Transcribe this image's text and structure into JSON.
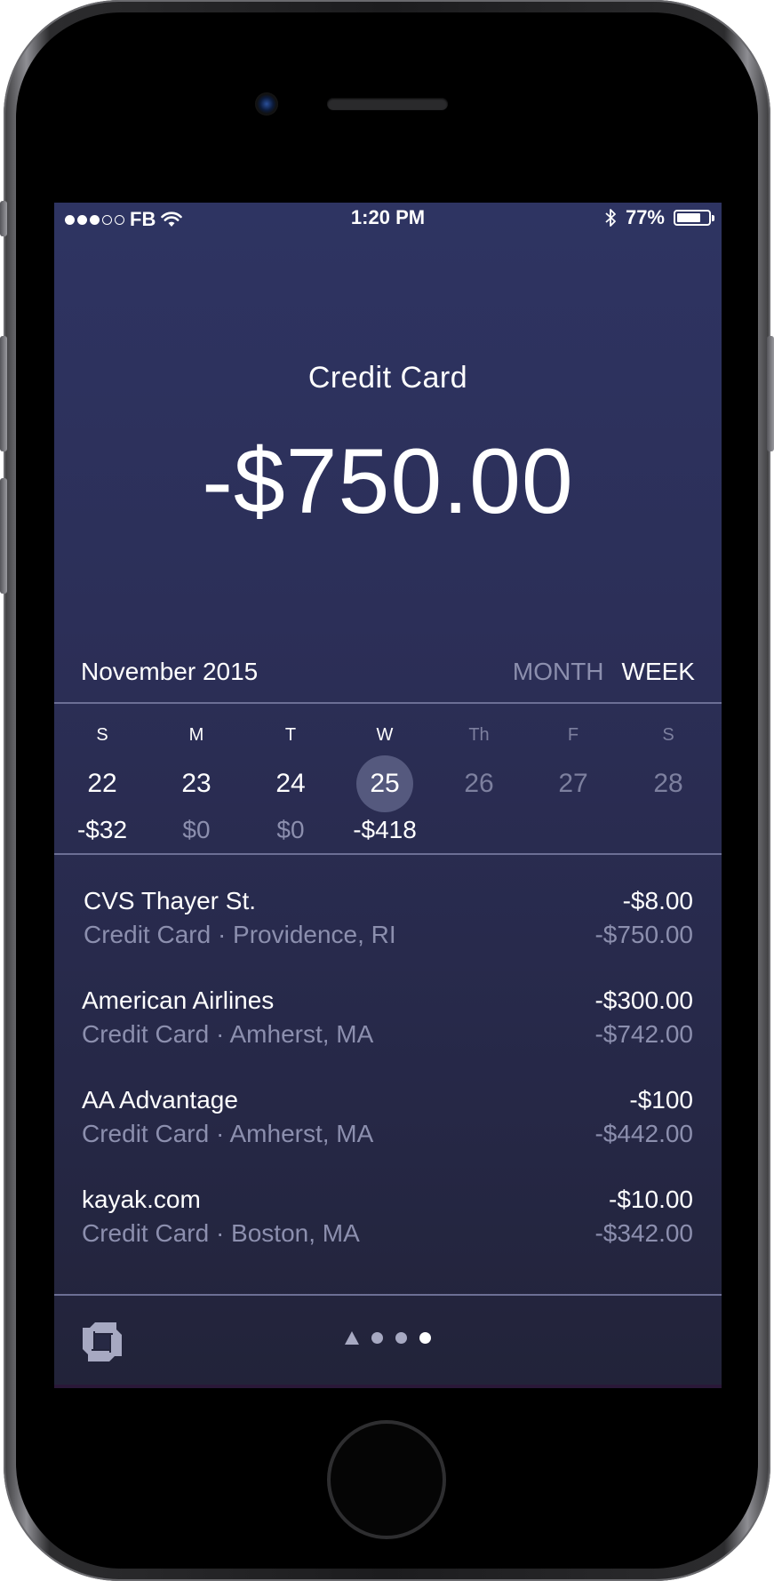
{
  "status_bar": {
    "carrier": "FB",
    "signal_bars_filled": 3,
    "signal_bars_total": 5,
    "time": "1:20 PM",
    "battery_text": "77%",
    "battery_level": 0.77,
    "icons": [
      "wifi-icon",
      "bluetooth-icon",
      "battery-icon"
    ]
  },
  "account": {
    "title": "Credit Card",
    "balance": "-$750.00"
  },
  "period": {
    "month": "November 2015",
    "toggle_month": "MONTH",
    "toggle_week": "WEEK",
    "active": "WEEK"
  },
  "week": {
    "days": [
      {
        "letter": "S",
        "num": "22",
        "amount": "-$32"
      },
      {
        "letter": "M",
        "num": "23",
        "amount": "$0"
      },
      {
        "letter": "T",
        "num": "24",
        "amount": "$0"
      },
      {
        "letter": "W",
        "num": "25",
        "amount": "-$418"
      },
      {
        "letter": "Th",
        "num": "26",
        "amount": ""
      },
      {
        "letter": "F",
        "num": "27",
        "amount": ""
      },
      {
        "letter": "S",
        "num": "28",
        "amount": ""
      }
    ],
    "selected_day": "25"
  },
  "transactions": [
    {
      "name": "CVS Thayer St.",
      "account": "Credit Card",
      "location": "Providence, RI",
      "amount": "-$8.00",
      "running": "-$750.00"
    },
    {
      "name": "American Airlines",
      "account": "Credit Card",
      "location": "Amherst, MA",
      "amount": "-$300.00",
      "running": "-$742.00"
    },
    {
      "name": "AA Advantage",
      "account": "Credit Card",
      "location": "Amherst, MA",
      "amount": "-$100",
      "running": "-$442.00"
    },
    {
      "name": "kayak.com",
      "account": "Credit Card",
      "location": "Boston, MA",
      "amount": "-$10.00",
      "running": "-$342.00"
    }
  ],
  "transaction_subtitles": [
    "Credit Card · Providence, RI",
    "Credit Card · Amherst, MA",
    "Credit Card · Amherst, MA",
    "Credit Card · Boston, MA"
  ],
  "bottom_bar": {
    "logo_icon": "chase-octagon-logo",
    "pager": {
      "items": [
        "location-arrow-icon",
        "dot",
        "dot",
        "dot"
      ],
      "active_index": 3
    }
  },
  "colors": {
    "screen_top": "#2e3462",
    "screen_bottom": "#222339",
    "muted_text": "#8c8fae",
    "selected_day_bg": "#55597e",
    "divider": "#6c6f95"
  }
}
